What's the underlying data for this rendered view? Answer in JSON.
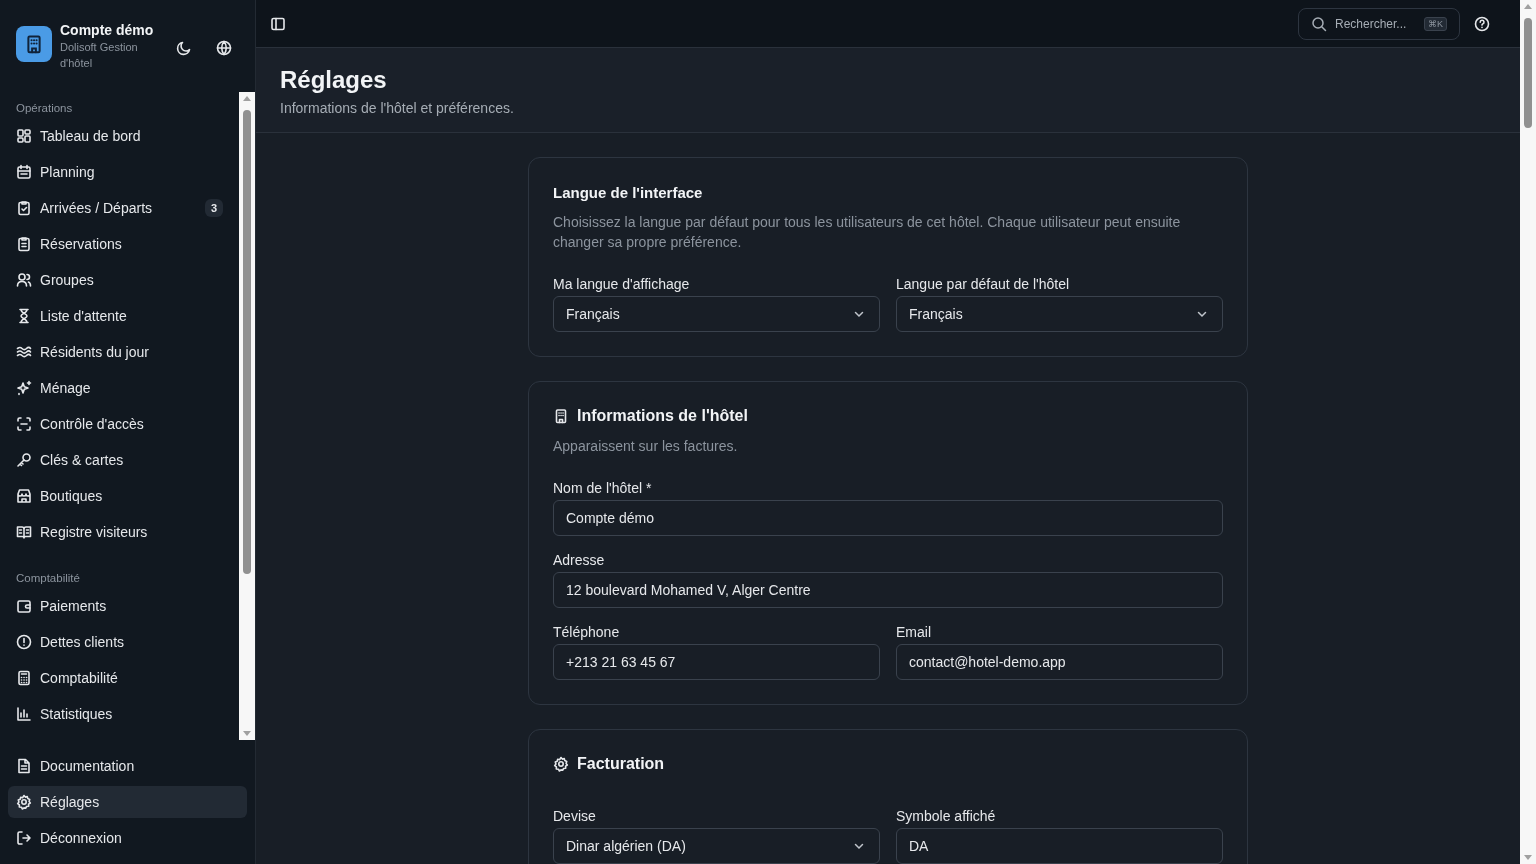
{
  "sidebar": {
    "brand": {
      "name": "Compte démo",
      "subtitle": "Dolisoft Gestion d'hôtel"
    },
    "sections": [
      {
        "label": "Opérations",
        "items": [
          {
            "label": "Tableau de bord",
            "selected": false
          },
          {
            "label": "Planning",
            "selected": false
          },
          {
            "label": "Arrivées / Départs",
            "badge": "3",
            "selected": false
          },
          {
            "label": "Réservations",
            "selected": false
          },
          {
            "label": "Groupes",
            "selected": false
          },
          {
            "label": "Liste d'attente",
            "selected": false
          },
          {
            "label": "Résidents du jour",
            "selected": false
          },
          {
            "label": "Ménage",
            "selected": false
          },
          {
            "label": "Contrôle d'accès",
            "selected": false
          },
          {
            "label": "Clés & cartes",
            "selected": false
          },
          {
            "label": "Boutiques",
            "selected": false
          },
          {
            "label": "Registre visiteurs",
            "selected": false
          }
        ]
      },
      {
        "label": "Comptabilité",
        "items": [
          {
            "label": "Paiements",
            "selected": false
          },
          {
            "label": "Dettes clients",
            "selected": false
          },
          {
            "label": "Comptabilité",
            "selected": false
          },
          {
            "label": "Statistiques",
            "selected": false
          }
        ]
      }
    ],
    "footer_items": [
      {
        "label": "Documentation",
        "selected": false
      },
      {
        "label": "Réglages",
        "selected": true
      },
      {
        "label": "Déconnexion",
        "selected": false
      }
    ]
  },
  "topbar": {
    "search": {
      "placeholder": "Rechercher...",
      "shortcut": "⌘K"
    }
  },
  "page": {
    "title": "Réglages",
    "subtitle": "Informations de l'hôtel et préférences.",
    "cards": [
      {
        "title": "Langue de l'interface",
        "description": "Choisissez la langue par défaut pour tous les utilisateurs de cet hôtel. Chaque utilisateur peut ensuite changer sa propre préférence.",
        "rows": [
          [
            {
              "label": "Ma langue d'affichage",
              "value": "Français",
              "kind": "select"
            },
            {
              "label": "Langue par défaut de l'hôtel",
              "value": "Français",
              "kind": "select"
            }
          ]
        ]
      },
      {
        "title": "Informations de l'hôtel",
        "description": "Apparaissent sur les factures.",
        "rows": [
          [
            {
              "label": "Nom de l'hôtel *",
              "value": "Compte démo",
              "kind": "text"
            }
          ],
          [
            {
              "label": "Adresse",
              "value": "12 boulevard Mohamed V, Alger Centre",
              "kind": "text"
            }
          ],
          [
            {
              "label": "Téléphone",
              "value": "+213 21 63 45 67",
              "kind": "text"
            },
            {
              "label": "Email",
              "value": "contact@hotel-demo.app",
              "kind": "text"
            }
          ]
        ]
      },
      {
        "title": "Facturation",
        "rows": [
          [
            {
              "label": "Devise",
              "value": "Dinar algérien (DA)",
              "kind": "select"
            },
            {
              "label": "Symbole affiché",
              "value": "DA",
              "kind": "text"
            }
          ]
        ]
      }
    ]
  }
}
